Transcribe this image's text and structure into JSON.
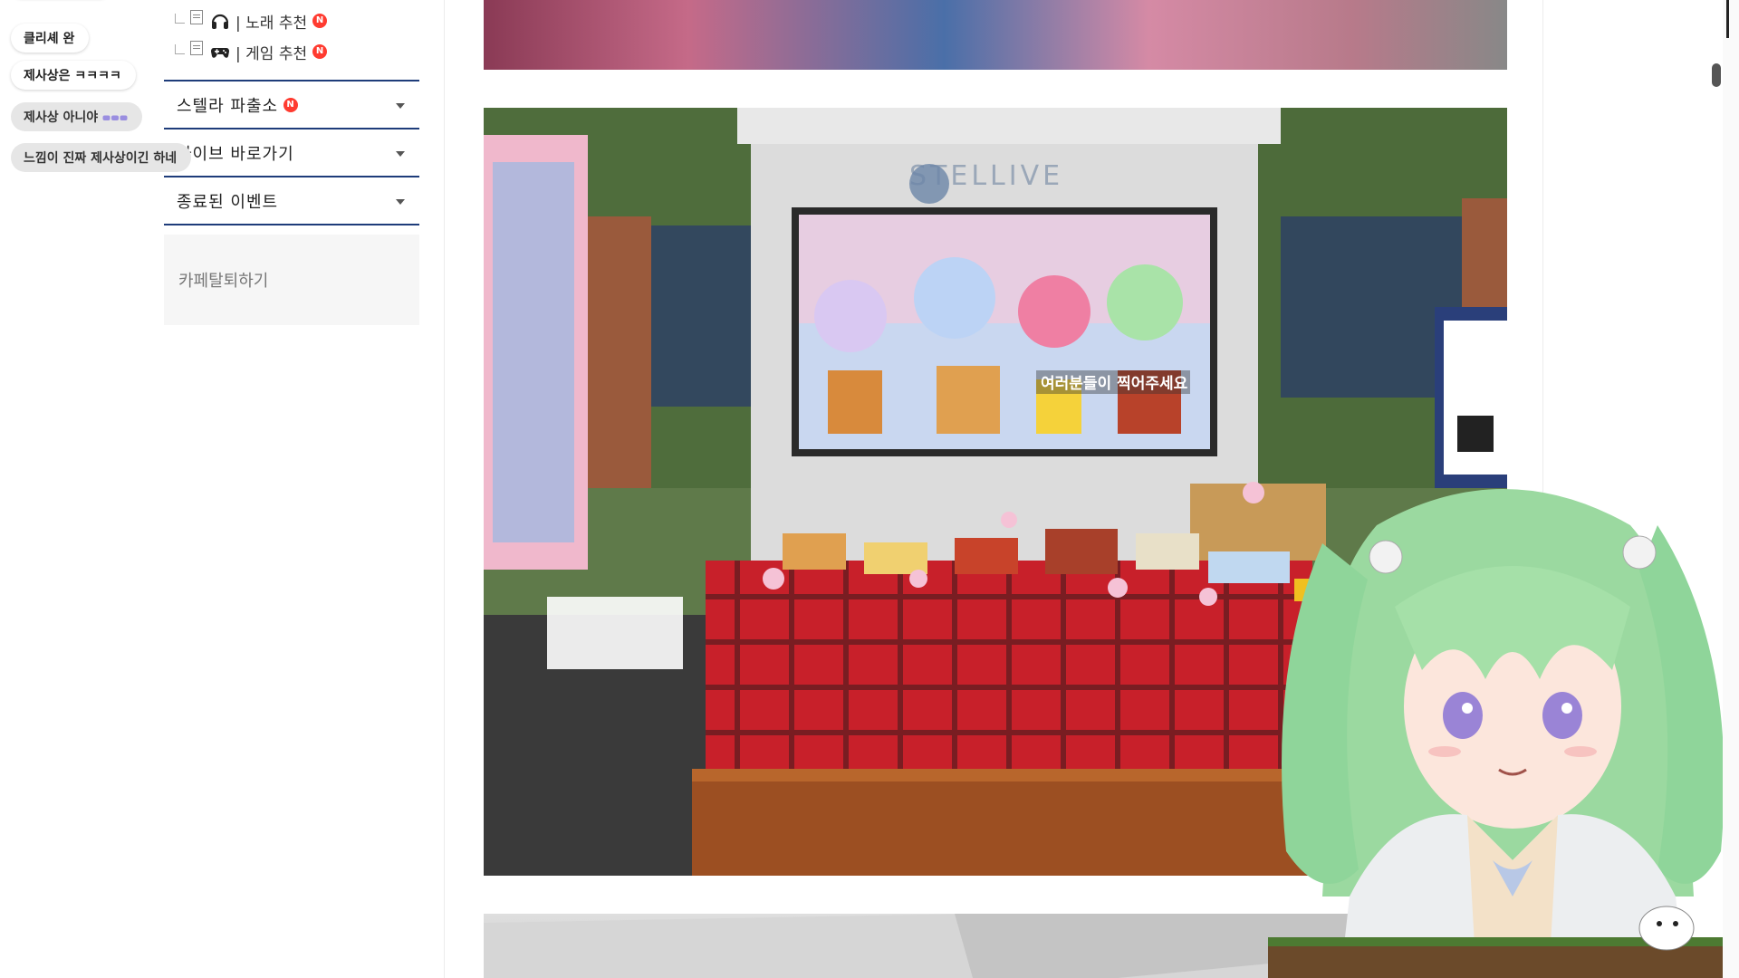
{
  "chat": {
    "messages": [
      {
        "text": "클리셰 완"
      },
      {
        "text": "제사상은 ㅋㅋㅋㅋ"
      },
      {
        "text": "제사상 아니야"
      },
      {
        "text": "느낌이 진짜 제사상이긴 하네"
      }
    ]
  },
  "menu": {
    "sub_items": [
      {
        "label": "| 노래 추천",
        "icon": "headphones-icon",
        "new": "N"
      },
      {
        "label": "| 게임 추천",
        "icon": "gamepad-icon",
        "new": "N"
      }
    ],
    "categories": [
      {
        "label": "스텔라 파출소",
        "new": "N"
      },
      {
        "label": "라이브 바로가기"
      },
      {
        "label": "종료된 이벤트"
      }
    ],
    "leave_cafe": "카페탈퇴하기"
  },
  "photo_main": {
    "sign_text": "STELLIVE",
    "banner_caption": "여러분들이 찍어주세요"
  },
  "colors": {
    "menu_rule": "#1e3c7a",
    "new_badge": "#ff3b30",
    "tablecloth": "#c8202a"
  }
}
